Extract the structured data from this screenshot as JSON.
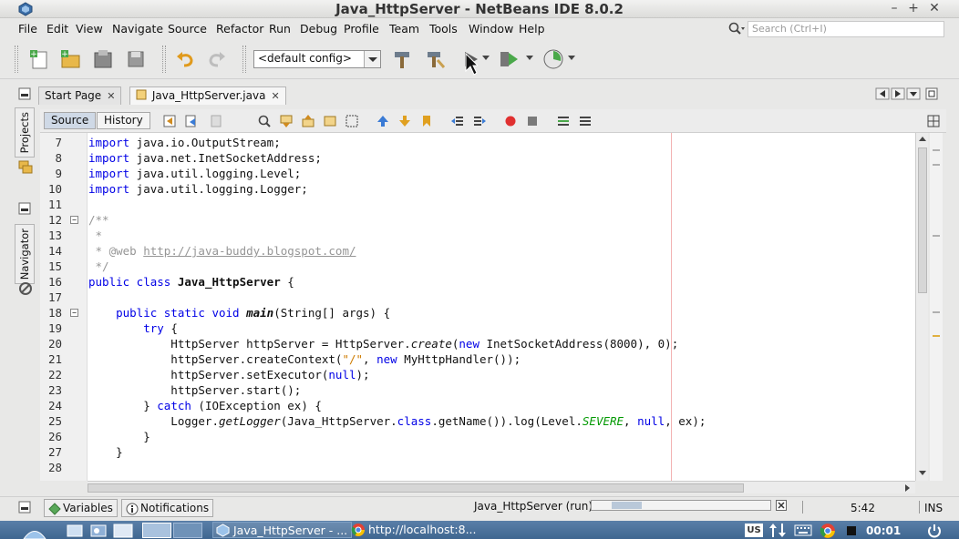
{
  "window": {
    "title": "Java_HttpServer - NetBeans IDE 8.0.2",
    "minimize": "–",
    "maximize": "+",
    "close": "✕"
  },
  "menu": [
    "File",
    "Edit",
    "View",
    "Navigate",
    "Source",
    "Refactor",
    "Run",
    "Debug",
    "Profile",
    "Team",
    "Tools",
    "Window",
    "Help"
  ],
  "search": {
    "placeholder": "Search (Ctrl+I)"
  },
  "toolbar": {
    "config": "<default config>"
  },
  "tabs": [
    {
      "label": "Start Page"
    },
    {
      "label": "Java_HttpServer.java"
    }
  ],
  "editor_view": {
    "source": "Source",
    "history": "History"
  },
  "side_panels": {
    "projects": "Projects",
    "navigator": "Navigator"
  },
  "code_lines": [
    {
      "n": "7"
    },
    {
      "n": "8"
    },
    {
      "n": "9"
    },
    {
      "n": "10"
    },
    {
      "n": "11"
    },
    {
      "n": "12"
    },
    {
      "n": "13"
    },
    {
      "n": "14"
    },
    {
      "n": "15"
    },
    {
      "n": "16"
    },
    {
      "n": "17"
    },
    {
      "n": "18"
    },
    {
      "n": "19"
    },
    {
      "n": "20"
    },
    {
      "n": "21"
    },
    {
      "n": "22"
    },
    {
      "n": "23"
    },
    {
      "n": "24"
    },
    {
      "n": "25"
    },
    {
      "n": "26"
    },
    {
      "n": "27"
    },
    {
      "n": "28"
    }
  ],
  "code": {
    "l7": [
      "import",
      " java.io.OutputStream;"
    ],
    "l8": [
      "import",
      " java.net.InetSocketAddress;"
    ],
    "l9": [
      "import",
      " java.util.logging.Level;"
    ],
    "l10": [
      "import",
      " java.util.logging.Logger;"
    ],
    "l12": "/**",
    "l13": " *",
    "l14": [
      " * @web ",
      "http://java-buddy.blogspot.com/"
    ],
    "l15": " */",
    "l16": [
      "public class ",
      "Java_HttpServer",
      " {"
    ],
    "l18": [
      "    public static void ",
      "main",
      "(String[] args) {"
    ],
    "l19": [
      "        ",
      "try",
      " {"
    ],
    "l20": [
      "            HttpServer httpServer = HttpServer.",
      "create",
      "(",
      "new",
      " InetSocketAddress(8000), 0);"
    ],
    "l21": [
      "            httpServer.createContext(",
      "\"/\"",
      ", ",
      "new",
      " MyHttpHandler());"
    ],
    "l22": [
      "            httpServer.setExecutor(",
      "null",
      ");"
    ],
    "l23": "            httpServer.start();",
    "l24": [
      "        } ",
      "catch",
      " (IOException ex) {"
    ],
    "l25": [
      "            Logger.",
      "getLogger",
      "(Java_HttpServer.",
      "class",
      ".getName()).log(Level.",
      "SEVERE",
      ", ",
      "null",
      ", ex);"
    ],
    "l26": "        }",
    "l27": "    }"
  },
  "status": {
    "variables": "Variables",
    "notifications": "Notifications",
    "run": "Java_HttpServer (run)",
    "position": "5:42",
    "mode": "INS",
    "progress": 0.28
  },
  "taskbar": {
    "netbeans": "Java_HttpServer - ...",
    "browser": "http://localhost:8...",
    "lang": "US",
    "clock": "00:01"
  }
}
